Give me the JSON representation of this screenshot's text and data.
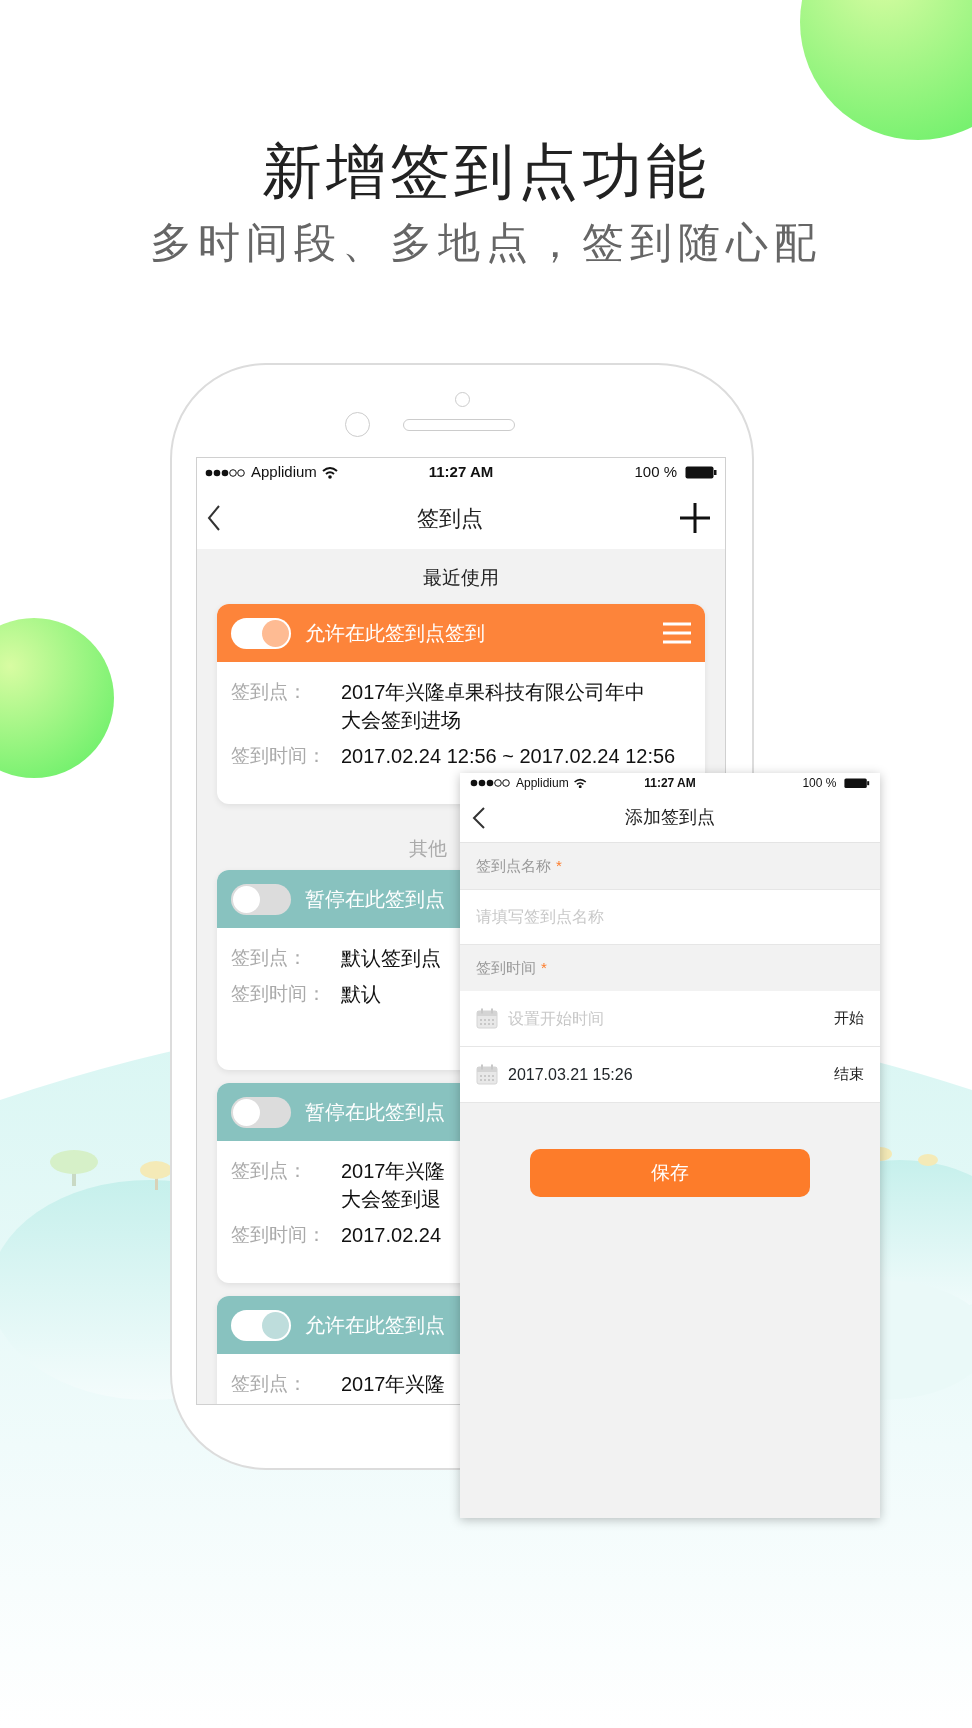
{
  "headline": "新增签到点功能",
  "subheadline": "多时间段、多地点，签到随心配",
  "phone": {
    "status_bar": {
      "carrier": "Applidium",
      "time": "11:27 AM",
      "battery": "100 %"
    },
    "title": "签到点",
    "sections": [
      {
        "title": "最近使用",
        "cards": [
          {
            "status": "允许在此签到点签到",
            "on": true,
            "color": "#fd843a",
            "menu_icon": true,
            "rows": [
              {
                "label": "签到点：",
                "lines": [
                  "2017年兴隆卓果科技有限公司年中",
                  "大会签到进场"
                ]
              },
              {
                "label": "签到时间：",
                "lines": [
                  "2017.02.24 12:56 ~ 2017.02.24 12:56"
                ]
              }
            ]
          }
        ]
      },
      {
        "title": "其他",
        "cards": [
          {
            "status": "暂停在此签到点",
            "on": false,
            "color": "#88c2bf",
            "menu_icon": false,
            "rows": [
              {
                "label": "签到点：",
                "lines": [
                  "默认签到点"
                ]
              },
              {
                "label": "签到时间：",
                "lines": [
                  "默认"
                ]
              }
            ]
          },
          {
            "status": "暂停在此签到点",
            "on": false,
            "color": "#88c2bf",
            "menu_icon": false,
            "rows": [
              {
                "label": "签到点：",
                "lines": [
                  "2017年兴隆",
                  "大会签到退"
                ]
              },
              {
                "label": "签到时间：",
                "lines": [
                  "2017.02.24"
                ]
              }
            ]
          },
          {
            "status": "允许在此签到点",
            "on": true,
            "color": "#88c2bf",
            "menu_icon": false,
            "rows": [
              {
                "label": "签到点：",
                "lines": [
                  "2017年兴隆"
                ]
              }
            ]
          }
        ]
      }
    ]
  },
  "form_screen": {
    "status_bar": {
      "carrier": "Applidium",
      "time": "11:27 AM",
      "battery": "100 %"
    },
    "title": "添加签到点",
    "items": [
      {
        "kind": "label",
        "text": "签到点名称",
        "required_mark": "*"
      },
      {
        "kind": "input",
        "placeholder": "请填写签到点名称"
      },
      {
        "kind": "label",
        "text": "签到时间",
        "required_mark": "*"
      },
      {
        "kind": "time",
        "placeholder": "设置开始时间",
        "tag": "开始"
      },
      {
        "kind": "time",
        "value": "2017.03.21  15:26",
        "tag": "结束"
      }
    ],
    "save": "保存"
  }
}
